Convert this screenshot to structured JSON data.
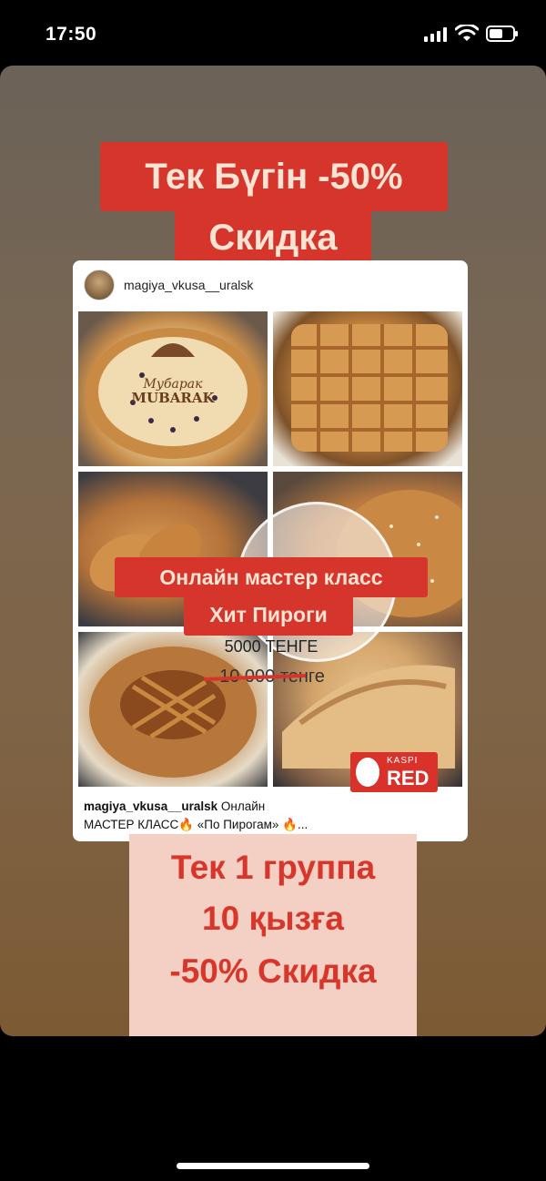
{
  "status_bar": {
    "time": "17:50",
    "signal_icon": "signal-bars-icon",
    "wifi_icon": "wifi-icon",
    "battery_icon": "battery-icon"
  },
  "story": {
    "headline_line1": "Тек Бүгін -50%",
    "headline_line2": "Скидка",
    "post": {
      "username": "magiya_vkusa__uralsk",
      "overlay_line1": "Онлайн мастер класс",
      "overlay_line2": "Хит Пироги",
      "price_new": "5000 ТЕНГЕ",
      "price_old": "10 000 тенге",
      "badge_top": "KASPI",
      "badge_text": "RED",
      "caption_user": "magiya_vkusa__uralsk",
      "caption_text": " Онлайн",
      "caption_line2": "МАСТЕР КЛАСС🔥 «По Пирогам» 🔥...",
      "tile1_text": "Мубарак",
      "tile1_text2": "MUBARAK"
    },
    "promo_line1": "Тек 1 группа",
    "promo_line2": "10 қызға",
    "promo_line3": "-50% Скидка"
  },
  "colors": {
    "accent_red": "#d6352b",
    "promo_bg": "#f3cfc4",
    "promo_text": "#d9362b"
  }
}
